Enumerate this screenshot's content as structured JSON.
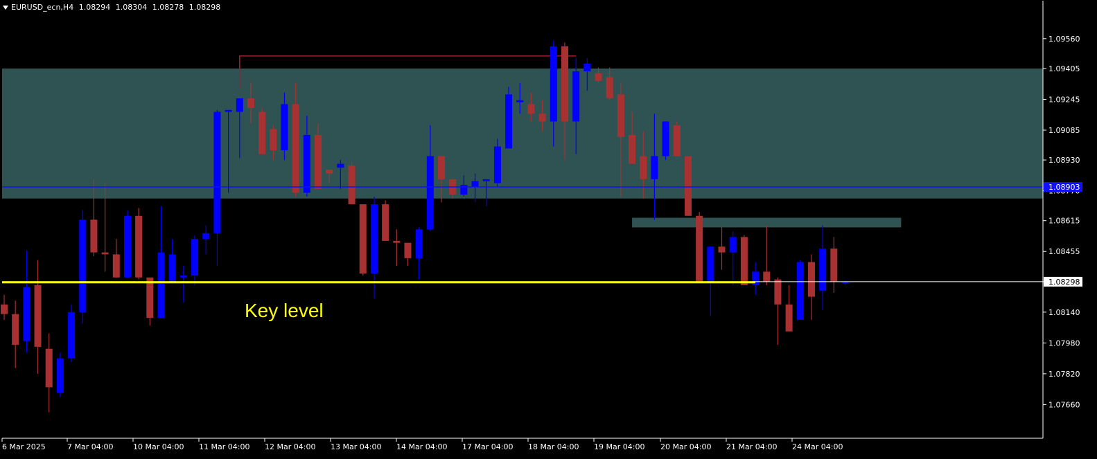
{
  "header": {
    "symbol": "EURUSD_ecn,H4",
    "open": "1.08294",
    "high": "1.08304",
    "low": "1.08278",
    "close": "1.08298"
  },
  "colors": {
    "background": "#000000",
    "bull": "#0000ff",
    "bear": "#a83232",
    "zone": "#2f5252",
    "blue_line": "#1010ff",
    "key_level": "#ffff00",
    "text": "#ffffff",
    "top_marker": "#a01e32"
  },
  "chart_data": {
    "type": "candlestick",
    "timeframe": "H4",
    "ylim": [
      1.0755,
      1.0966
    ],
    "y_ticks": [
      "1.09560",
      "1.09405",
      "1.09245",
      "1.09085",
      "1.08930",
      "1.08770",
      "1.08615",
      "1.08455",
      "1.08298",
      "1.08140",
      "1.07980",
      "1.07820",
      "1.07660"
    ],
    "x_ticks": [
      "6 Mar 2025",
      "7 Mar 04:00",
      "10 Mar 04:00",
      "11 Mar 04:00",
      "12 Mar 04:00",
      "13 Mar 04:00",
      "14 Mar 04:00",
      "17 Mar 04:00",
      "18 Mar 04:00",
      "19 Mar 04:00",
      "20 Mar 04:00",
      "21 Mar 04:00",
      "24 Mar 04:00"
    ],
    "candles": [
      {
        "o": 1.0818,
        "h": 1.0823,
        "l": 1.081,
        "c": 1.0813
      },
      {
        "o": 1.0813,
        "h": 1.082,
        "l": 1.0785,
        "c": 1.0797
      },
      {
        "o": 1.0799,
        "h": 1.0846,
        "l": 1.0793,
        "c": 1.0827
      },
      {
        "o": 1.0828,
        "h": 1.0841,
        "l": 1.0782,
        "c": 1.0796
      },
      {
        "o": 1.0795,
        "h": 1.0803,
        "l": 1.0762,
        "c": 1.0775
      },
      {
        "o": 1.0772,
        "h": 1.0793,
        "l": 1.077,
        "c": 1.079
      },
      {
        "o": 1.079,
        "h": 1.0818,
        "l": 1.0788,
        "c": 1.0814
      },
      {
        "o": 1.0814,
        "h": 1.0867,
        "l": 1.0808,
        "c": 1.0862
      },
      {
        "o": 1.0862,
        "h": 1.0883,
        "l": 1.0843,
        "c": 1.0845
      },
      {
        "o": 1.0845,
        "h": 1.0881,
        "l": 1.0835,
        "c": 1.0844
      },
      {
        "o": 1.0844,
        "h": 1.0852,
        "l": 1.0832,
        "c": 1.0832
      },
      {
        "o": 1.0832,
        "h": 1.0867,
        "l": 1.0832,
        "c": 1.0864
      },
      {
        "o": 1.0864,
        "h": 1.0868,
        "l": 1.0831,
        "c": 1.0832
      },
      {
        "o": 1.0832,
        "h": 1.0832,
        "l": 1.0807,
        "c": 1.0811
      },
      {
        "o": 1.0811,
        "h": 1.0869,
        "l": 1.0811,
        "c": 1.0845
      },
      {
        "o": 1.0829,
        "h": 1.0852,
        "l": 1.0829,
        "c": 1.0844
      },
      {
        "o": 1.0832,
        "h": 1.0838,
        "l": 1.0819,
        "c": 1.0833
      },
      {
        "o": 1.0833,
        "h": 1.0854,
        "l": 1.0828,
        "c": 1.0852
      },
      {
        "o": 1.0852,
        "h": 1.0859,
        "l": 1.0844,
        "c": 1.0855
      },
      {
        "o": 1.0855,
        "h": 1.0919,
        "l": 1.0838,
        "c": 1.0918
      },
      {
        "o": 1.0918,
        "h": 1.0918,
        "l": 1.0876,
        "c": 1.0919
      },
      {
        "o": 1.0918,
        "h": 1.0923,
        "l": 1.0894,
        "c": 1.0925
      },
      {
        "o": 1.0925,
        "h": 1.0933,
        "l": 1.0912,
        "c": 1.092
      },
      {
        "o": 1.0918,
        "h": 1.092,
        "l": 1.0904,
        "c": 1.0896
      },
      {
        "o": 1.0909,
        "h": 1.0911,
        "l": 1.0893,
        "c": 1.0898
      },
      {
        "o": 1.0898,
        "h": 1.0928,
        "l": 1.0893,
        "c": 1.0922
      },
      {
        "o": 1.0922,
        "h": 1.0933,
        "l": 1.0874,
        "c": 1.0876
      },
      {
        "o": 1.0876,
        "h": 1.0916,
        "l": 1.0874,
        "c": 1.0906
      },
      {
        "o": 1.0906,
        "h": 1.0912,
        "l": 1.0879,
        "c": 1.0878
      },
      {
        "o": 1.0888,
        "h": 1.0888,
        "l": 1.0881,
        "c": 1.0886
      },
      {
        "o": 1.0889,
        "h": 1.0893,
        "l": 1.0878,
        "c": 1.0891
      },
      {
        "o": 1.089,
        "h": 1.0892,
        "l": 1.087,
        "c": 1.087
      },
      {
        "o": 1.087,
        "h": 1.087,
        "l": 1.0833,
        "c": 1.0834
      },
      {
        "o": 1.0834,
        "h": 1.0874,
        "l": 1.0821,
        "c": 1.087
      },
      {
        "o": 1.087,
        "h": 1.0872,
        "l": 1.0851,
        "c": 1.0851
      },
      {
        "o": 1.0851,
        "h": 1.0857,
        "l": 1.0838,
        "c": 1.085
      },
      {
        "o": 1.085,
        "h": 1.085,
        "l": 1.0838,
        "c": 1.0842
      },
      {
        "o": 1.0842,
        "h": 1.0858,
        "l": 1.0831,
        "c": 1.0857
      },
      {
        "o": 1.0857,
        "h": 1.0911,
        "l": 1.0856,
        "c": 1.0895
      },
      {
        "o": 1.0895,
        "h": 1.0895,
        "l": 1.0871,
        "c": 1.0883
      },
      {
        "o": 1.0883,
        "h": 1.0883,
        "l": 1.0873,
        "c": 1.0875
      },
      {
        "o": 1.0875,
        "h": 1.0885,
        "l": 1.0874,
        "c": 1.088
      },
      {
        "o": 1.0879,
        "h": 1.0886,
        "l": 1.0871,
        "c": 1.0882
      },
      {
        "o": 1.0882,
        "h": 1.0883,
        "l": 1.0869,
        "c": 1.0883
      },
      {
        "o": 1.0881,
        "h": 1.0904,
        "l": 1.0879,
        "c": 1.09
      },
      {
        "o": 1.0899,
        "h": 1.0931,
        "l": 1.0899,
        "c": 1.0927
      },
      {
        "o": 1.0923,
        "h": 1.0933,
        "l": 1.0917,
        "c": 1.0924
      },
      {
        "o": 1.0922,
        "h": 1.0928,
        "l": 1.0913,
        "c": 1.0917
      },
      {
        "o": 1.0917,
        "h": 1.0924,
        "l": 1.0908,
        "c": 1.0913
      },
      {
        "o": 1.0913,
        "h": 1.0955,
        "l": 1.09,
        "c": 1.0952
      },
      {
        "o": 1.0952,
        "h": 1.0954,
        "l": 1.0893,
        "c": 1.0913
      },
      {
        "o": 1.0913,
        "h": 1.0946,
        "l": 1.0896,
        "c": 1.0939
      },
      {
        "o": 1.0939,
        "h": 1.0946,
        "l": 1.0929,
        "c": 1.0943
      },
      {
        "o": 1.0938,
        "h": 1.0941,
        "l": 1.0933,
        "c": 1.0934
      },
      {
        "o": 1.0936,
        "h": 1.0941,
        "l": 1.0924,
        "c": 1.0925
      },
      {
        "o": 1.0927,
        "h": 1.0933,
        "l": 1.0874,
        "c": 1.0905
      },
      {
        "o": 1.0906,
        "h": 1.0918,
        "l": 1.0891,
        "c": 1.0891
      },
      {
        "o": 1.0895,
        "h": 1.0908,
        "l": 1.0873,
        "c": 1.0883
      },
      {
        "o": 1.0883,
        "h": 1.0917,
        "l": 1.0862,
        "c": 1.0895
      },
      {
        "o": 1.0895,
        "h": 1.0909,
        "l": 1.0893,
        "c": 1.0913
      },
      {
        "o": 1.0911,
        "h": 1.0913,
        "l": 1.0896,
        "c": 1.0895
      },
      {
        "o": 1.0895,
        "h": 1.0894,
        "l": 1.0864,
        "c": 1.0864
      },
      {
        "o": 1.0864,
        "h": 1.0866,
        "l": 1.0834,
        "c": 1.083
      },
      {
        "o": 1.083,
        "h": 1.0846,
        "l": 1.0812,
        "c": 1.0848
      },
      {
        "o": 1.0848,
        "h": 1.0858,
        "l": 1.0836,
        "c": 1.0845
      },
      {
        "o": 1.0845,
        "h": 1.0856,
        "l": 1.0828,
        "c": 1.0853
      },
      {
        "o": 1.0853,
        "h": 1.0854,
        "l": 1.0828,
        "c": 1.0828
      },
      {
        "o": 1.0828,
        "h": 1.084,
        "l": 1.0823,
        "c": 1.0835
      },
      {
        "o": 1.0835,
        "h": 1.0859,
        "l": 1.0828,
        "c": 1.083
      },
      {
        "o": 1.0831,
        "h": 1.0832,
        "l": 1.0797,
        "c": 1.0818
      },
      {
        "o": 1.0818,
        "h": 1.0828,
        "l": 1.0807,
        "c": 1.0804
      },
      {
        "o": 1.081,
        "h": 1.0841,
        "l": 1.0811,
        "c": 1.084
      },
      {
        "o": 1.084,
        "h": 1.0844,
        "l": 1.081,
        "c": 1.0822
      },
      {
        "o": 1.0825,
        "h": 1.0859,
        "l": 1.0815,
        "c": 1.0847
      },
      {
        "o": 1.0847,
        "h": 1.0853,
        "l": 1.0824,
        "c": 1.083
      },
      {
        "o": 1.08294,
        "h": 1.08304,
        "l": 1.08278,
        "c": 1.08298
      }
    ],
    "zones": [
      {
        "from_index": -1,
        "to_index": "end",
        "top": 1.09405,
        "bottom": 1.0873
      },
      {
        "from_index": 56,
        "to_index": 80,
        "top": 1.0863,
        "bottom": 1.0858
      }
    ],
    "horizontal_lines": [
      {
        "price": 1.0879,
        "label": "1.08903",
        "color": "#1010ff"
      },
      {
        "price": 1.08298,
        "label": "1.08298",
        "color": "#ffffff"
      }
    ],
    "key_level": {
      "price": 1.08295,
      "to_index": 67,
      "label": "Key level"
    },
    "top_marker": {
      "from_index": 21,
      "to_index": 51,
      "price": 1.0947
    }
  }
}
